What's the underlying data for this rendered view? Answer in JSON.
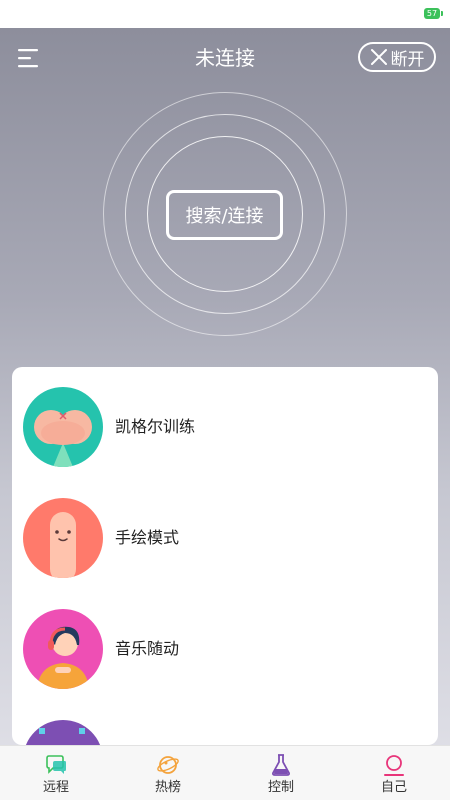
{
  "status_bar": {
    "battery_text": "57"
  },
  "header": {
    "title": "未连接",
    "disconnect_label": "断开"
  },
  "scan": {
    "button_label": "搜索/连接"
  },
  "modes": [
    {
      "label": "凯格尔训练",
      "icon": "kegel-avatar"
    },
    {
      "label": "手绘模式",
      "icon": "finger-avatar"
    },
    {
      "label": "音乐随动",
      "icon": "music-avatar"
    },
    {
      "label": "",
      "icon": "partial-avatar"
    }
  ],
  "tab_bar": {
    "tabs": [
      {
        "label": "远程",
        "icon": "chat-icon"
      },
      {
        "label": "热榜",
        "icon": "planet-icon"
      },
      {
        "label": "控制",
        "icon": "flask-icon"
      },
      {
        "label": "自己",
        "icon": "person-icon",
        "active": true
      }
    ]
  },
  "colors": {
    "accent_pink": "#e8357a",
    "green": "#3cc15b",
    "teal": "#25c3ad",
    "orange": "#f4a33c",
    "purple": "#7d4fb3"
  }
}
